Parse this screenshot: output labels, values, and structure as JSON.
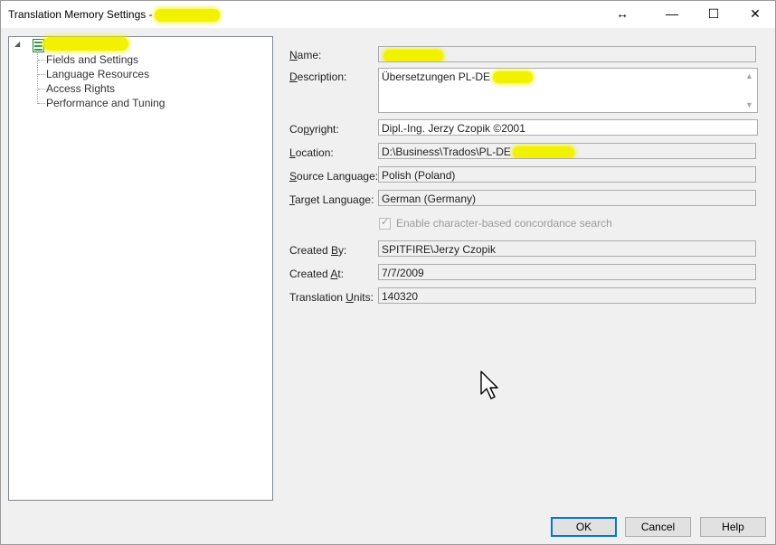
{
  "window": {
    "title": "Translation Memory Settings -",
    "resize_glyph": "↔",
    "minimize_glyph": "—",
    "maximize_glyph": "☐",
    "close_glyph": "✕"
  },
  "tree": {
    "expander_glyph": "◢",
    "root_icon": "database-icon",
    "items": [
      {
        "label": "Fields and Settings"
      },
      {
        "label": "Language Resources"
      },
      {
        "label": "Access Rights"
      },
      {
        "label": "Performance and Tuning"
      }
    ]
  },
  "form": {
    "name": {
      "label_pre": "",
      "label_ul": "N",
      "label_post": "ame:",
      "value": ""
    },
    "description": {
      "label_pre": "",
      "label_ul": "D",
      "label_post": "escription:",
      "value": "Übersetzungen PL-DE "
    },
    "copyright": {
      "label_pre": "Co",
      "label_ul": "p",
      "label_post": "yright:",
      "value": "Dipl.-Ing. Jerzy Czopik ©2001"
    },
    "location": {
      "label_pre": "",
      "label_ul": "L",
      "label_post": "ocation:",
      "value": "D:\\Business\\Trados\\PL-DE"
    },
    "source_language": {
      "label_pre": "",
      "label_ul": "S",
      "label_post": "ource Language:",
      "value": "Polish (Poland)"
    },
    "target_language": {
      "label_pre": "",
      "label_ul": "T",
      "label_post": "arget Language:",
      "value": "German (Germany)"
    },
    "concordance": {
      "label": "Enable character-based concordance search",
      "checked": true,
      "enabled": false
    },
    "created_by": {
      "label_pre": "Created ",
      "label_ul": "B",
      "label_post": "y:",
      "value": "SPITFIRE\\Jerzy Czopik"
    },
    "created_at": {
      "label_pre": "Created ",
      "label_ul": "A",
      "label_post": "t:",
      "value": "7/7/2009"
    },
    "translation_units": {
      "label_pre": "Translation ",
      "label_ul": "U",
      "label_post": "nits:",
      "value": "140320"
    }
  },
  "buttons": {
    "ok": "OK",
    "cancel": "Cancel",
    "help": "Help"
  },
  "colors": {
    "redaction_highlight": "#f2f200",
    "default_button_border": "#0078d7"
  }
}
